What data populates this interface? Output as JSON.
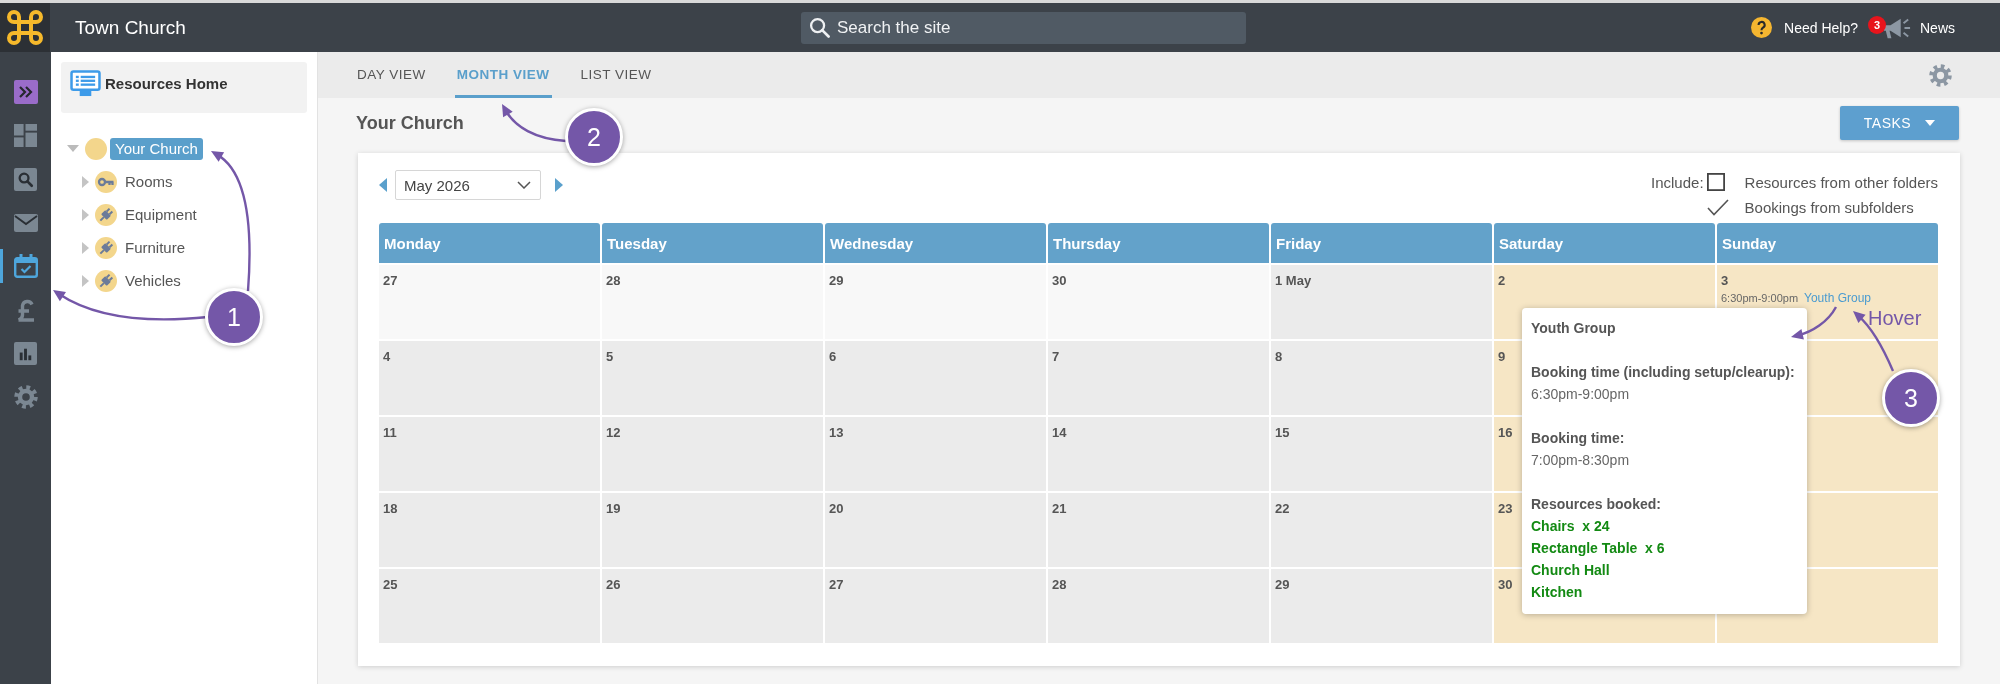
{
  "header": {
    "site_title": "Town Church",
    "search": {
      "placeholder": "Search the site"
    },
    "help": {
      "label": "Need Help?"
    },
    "news": {
      "label": "News",
      "badge": "3"
    }
  },
  "rail": {
    "items": [
      {
        "kind": "expand",
        "selected": false
      },
      {
        "kind": "dashboard",
        "selected": false
      },
      {
        "kind": "search",
        "selected": false
      },
      {
        "kind": "mail",
        "selected": false
      },
      {
        "kind": "calendar",
        "selected": true
      },
      {
        "kind": "finance",
        "selected": false
      },
      {
        "kind": "reports",
        "selected": false
      },
      {
        "kind": "settings",
        "selected": false
      }
    ]
  },
  "sidebar": {
    "home_link": "Resources Home",
    "tree": [
      {
        "label": "Your Church",
        "kind": "organisation",
        "expanded": true,
        "selected": true,
        "children": [
          {
            "label": "Rooms",
            "kind": "rooms",
            "expanded": false,
            "selected": false
          },
          {
            "label": "Equipment",
            "kind": "items",
            "expanded": false,
            "selected": false
          },
          {
            "label": "Furniture",
            "kind": "items",
            "expanded": false,
            "selected": false
          },
          {
            "label": "Vehicles",
            "kind": "items",
            "expanded": false,
            "selected": false
          }
        ]
      }
    ]
  },
  "tabs": [
    {
      "label": "DAY VIEW",
      "selected": false
    },
    {
      "label": "MONTH VIEW",
      "selected": true
    },
    {
      "label": "LIST VIEW",
      "selected": false
    }
  ],
  "page_title": "Your Church",
  "tasks_button": {
    "label": "TASKS"
  },
  "calendar": {
    "month_select": {
      "value": "May 2026"
    },
    "include": {
      "label": "Include:",
      "options": [
        {
          "label": "Resources from other folders",
          "checked": false
        },
        {
          "label": "Bookings from subfolders",
          "checked": true
        }
      ]
    },
    "columns": [
      "Monday",
      "Tuesday",
      "Wednesday",
      "Thursday",
      "Friday",
      "Saturday",
      "Sunday"
    ],
    "weeks": [
      [
        {
          "day": "27",
          "kind": "outside"
        },
        {
          "day": "28",
          "kind": "outside"
        },
        {
          "day": "29",
          "kind": "outside"
        },
        {
          "day": "30",
          "kind": "outside"
        },
        {
          "day": "1 May",
          "kind": "weekday"
        },
        {
          "day": "2",
          "kind": "weekend"
        },
        {
          "day": "3",
          "kind": "weekend",
          "events": [
            {
              "time": "6:30pm-9:00pm",
              "title": "Youth Group"
            }
          ]
        }
      ],
      [
        {
          "day": "4",
          "kind": "weekday"
        },
        {
          "day": "5",
          "kind": "weekday"
        },
        {
          "day": "6",
          "kind": "weekday"
        },
        {
          "day": "7",
          "kind": "weekday"
        },
        {
          "day": "8",
          "kind": "weekday"
        },
        {
          "day": "9",
          "kind": "weekend"
        },
        {
          "kind": "weekend"
        }
      ],
      [
        {
          "day": "11",
          "kind": "weekday"
        },
        {
          "day": "12",
          "kind": "weekday"
        },
        {
          "day": "13",
          "kind": "weekday"
        },
        {
          "day": "14",
          "kind": "weekday"
        },
        {
          "day": "15",
          "kind": "weekday"
        },
        {
          "day": "16",
          "kind": "weekend"
        },
        {
          "kind": "weekend"
        }
      ],
      [
        {
          "day": "18",
          "kind": "weekday"
        },
        {
          "day": "19",
          "kind": "weekday"
        },
        {
          "day": "20",
          "kind": "weekday"
        },
        {
          "day": "21",
          "kind": "weekday"
        },
        {
          "day": "22",
          "kind": "weekday"
        },
        {
          "day": "23",
          "kind": "weekend"
        },
        {
          "kind": "weekend"
        }
      ],
      [
        {
          "day": "25",
          "kind": "weekday"
        },
        {
          "day": "26",
          "kind": "weekday"
        },
        {
          "day": "27",
          "kind": "weekday"
        },
        {
          "day": "28",
          "kind": "weekday"
        },
        {
          "day": "29",
          "kind": "weekday"
        },
        {
          "day": "30",
          "kind": "weekend"
        },
        {
          "kind": "weekend"
        }
      ]
    ]
  },
  "popup": {
    "title": "Youth Group",
    "sections": [
      {
        "kind": "time",
        "heading": "Booking time (including setup/clearup):",
        "lines": [
          "6:30pm-9:00pm"
        ]
      },
      {
        "kind": "time",
        "heading": "Booking time:",
        "lines": [
          "7:00pm-8:30pm"
        ]
      },
      {
        "kind": "resources",
        "heading": "Resources booked:",
        "lines": [
          "Chairs  x 24",
          "Rectangle Table  x 6",
          "Church Hall",
          "Kitchen"
        ]
      }
    ]
  },
  "annotations": {
    "callouts": [
      "1",
      "2",
      "3"
    ],
    "hover_note": "Hover"
  }
}
